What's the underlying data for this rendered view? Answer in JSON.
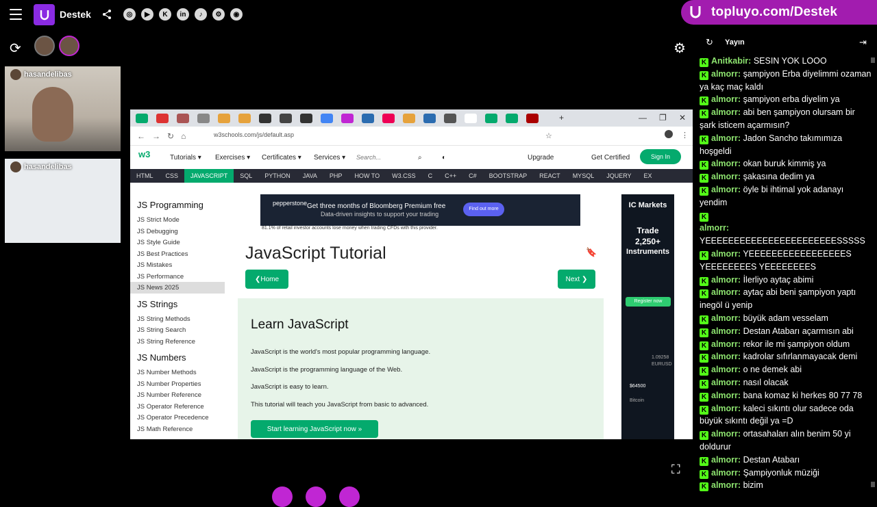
{
  "topbar": {
    "channel": "Destek",
    "social_icons": [
      "instagram-icon",
      "youtube-icon",
      "kick-icon",
      "linkedin-icon",
      "tiktok-icon",
      "steam-icon",
      "github-icon"
    ],
    "social_glyphs": [
      "◎",
      "▶",
      "K",
      "in",
      "♪",
      "⚙",
      "◉"
    ]
  },
  "banner": {
    "text": "topluyo.com/Destek",
    "color": "#a21caf"
  },
  "cams": [
    {
      "name": "hasandelibas"
    },
    {
      "name": "hasandelibas"
    }
  ],
  "browser": {
    "url": "w3schools.com/js/default.asp",
    "menu": [
      "Tutorials ▾",
      "Exercises ▾",
      "Certificates ▾",
      "Services ▾"
    ],
    "search_placeholder": "Search...",
    "upgrade": "Upgrade",
    "get_certified": "Get Certified",
    "signin": "Sign In",
    "langs": [
      "HTML",
      "CSS",
      "JAVASCRIPT",
      "SQL",
      "PYTHON",
      "JAVA",
      "PHP",
      "HOW TO",
      "W3.CSS",
      "C",
      "C++",
      "C#",
      "BOOTSTRAP",
      "REACT",
      "MYSQL",
      "JQUERY",
      "EX"
    ],
    "sidebar": [
      {
        "heading": "JS Programming",
        "items": [
          "JS Strict Mode",
          "JS Debugging",
          "JS Style Guide",
          "JS Best Practices",
          "JS Mistakes",
          "JS Performance",
          "JS News 2025"
        ]
      },
      {
        "heading": "JS Strings",
        "items": [
          "JS String Methods",
          "JS String Search",
          "JS String Reference"
        ]
      },
      {
        "heading": "JS Numbers",
        "items": [
          "JS Number Methods",
          "JS Number Properties",
          "JS Number Reference",
          "JS Operator Reference",
          "JS Operator Precedence",
          "JS Math Reference"
        ]
      }
    ],
    "ad1": {
      "brand": "pepperstone",
      "title": "Get three months of Bloomberg Premium free",
      "sub": "Data-driven insights to support your trading",
      "button": "Find out more",
      "disclaimer": "81.1% of retail investor accounts lose money when trading CFDs with this provider."
    },
    "page_title": "JavaScript Tutorial",
    "home": "❮Home",
    "next": "Next ❯",
    "learn_title": "Learn JavaScript",
    "paras": [
      "JavaScript is the world's most popular programming language.",
      "JavaScript is the programming language of the Web.",
      "JavaScript is easy to learn.",
      "This tutorial will teach you JavaScript from basic to advanced."
    ],
    "start": "Start learning JavaScript now »",
    "ad2": {
      "brand": "IC Markets",
      "line1": "Trade",
      "line2": "2,250+",
      "line3": "Instruments",
      "register": "Register now",
      "price1": "1.09258",
      "pair1": "EURUSD",
      "price2": "$64500",
      "pair2": "Bitcoin"
    }
  },
  "chat": {
    "title": "Yayın",
    "messages": [
      {
        "user": "Anitkabir:",
        "text": "SESIN YOK LOOO"
      },
      {
        "user": "almorr:",
        "text": "şampiyon Erba diyelimmi ozaman ya kaç maç kaldı"
      },
      {
        "user": "almorr:",
        "text": "şampiyon erba diyelim ya"
      },
      {
        "user": "almorr:",
        "text": "abi ben şampiyon olursam bir şark isticem açarmısın?"
      },
      {
        "user": "almorr:",
        "text": "Jadon Sancho takımımıza hoşgeldi"
      },
      {
        "user": "almorr:",
        "text": "okan buruk kimmiş ya"
      },
      {
        "user": "almorr:",
        "text": "şakasına dedim ya"
      },
      {
        "user": "almorr:",
        "text": "öyle bi ihtimal yok adanayı yendim"
      },
      {
        "user": "almorr:",
        "text": "YEEEEEEEEEEEEEEEEEEEEEEESSSSS",
        "newline": true
      },
      {
        "user": "almorr:",
        "text": "YEEEEEEEEEEEEEEEEES YEEEEEEEES YEEEEEEEES"
      },
      {
        "user": "almorr:",
        "text": "İlerliyo aytaç abimi"
      },
      {
        "user": "almorr:",
        "text": "aytaç abi beni şampiyon yaptı inegöl ü yenip"
      },
      {
        "user": "almorr:",
        "text": "büyük adam vesselam"
      },
      {
        "user": "almorr:",
        "text": "Destan Atabarı açarmısın abi"
      },
      {
        "user": "almorr:",
        "text": "rekor ile mi şampiyon oldum"
      },
      {
        "user": "almorr:",
        "text": "kadrolar sıfırlanmayacak demi"
      },
      {
        "user": "almorr:",
        "text": "o ne demek abi"
      },
      {
        "user": "almorr:",
        "text": "nasıl olacak"
      },
      {
        "user": "almorr:",
        "text": "bana komaz ki herkes 80 77 78"
      },
      {
        "user": "almorr:",
        "text": "kaleci sıkıntı olur sadece oda büyük sıkıntı değil ya =D"
      },
      {
        "user": "almorr:",
        "text": "ortasahaları alın benim 50 yi doldurur"
      },
      {
        "user": "almorr:",
        "text": "Destan Atabarı"
      },
      {
        "user": "almorr:",
        "text": "Şampiyonluk müziği"
      },
      {
        "user": "almorr:",
        "text": "bizim"
      }
    ]
  }
}
